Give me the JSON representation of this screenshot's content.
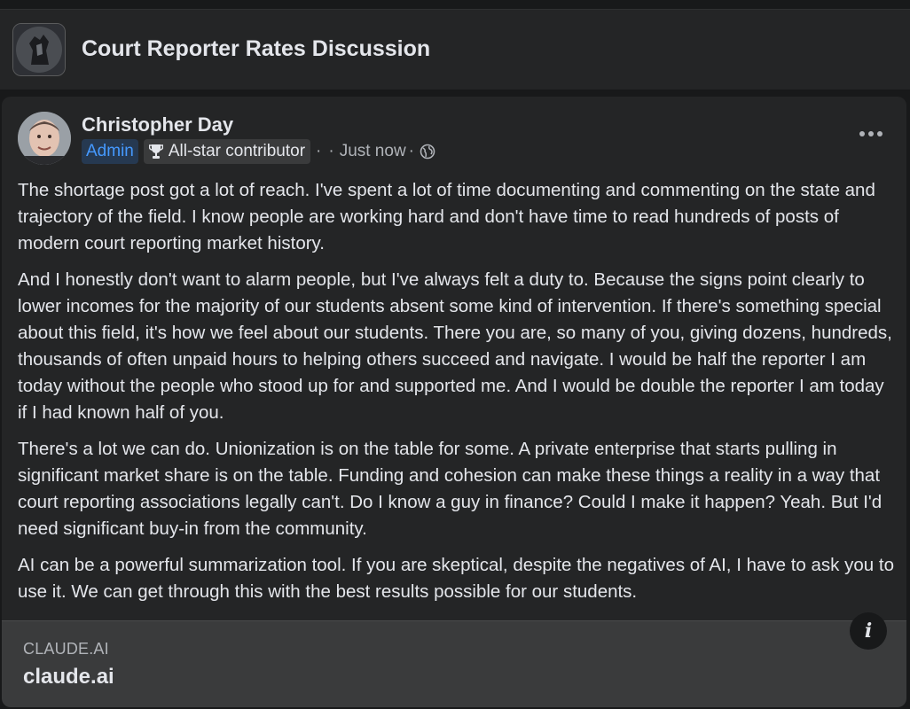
{
  "group": {
    "title": "Court Reporter Rates Discussion",
    "avatar_icon": "group-avatar-icon"
  },
  "post": {
    "author": "Christopher Day",
    "badges": {
      "admin": "Admin",
      "allstar": "All-star contributor"
    },
    "separator1": "·",
    "separator2": "·",
    "time": "Just now",
    "separator3": "·",
    "privacy_icon": "globe-icon",
    "more_icon": "more-options-icon",
    "paragraphs": [
      "The shortage post got a lot of reach. I've spent a lot of time documenting and commenting on the state and trajectory of the field. I know people are working hard and don't have time to read hundreds of posts of modern court reporting market history.",
      "And I honestly don't want to alarm people, but I've always felt a duty to. Because the signs point clearly to lower incomes for the majority of our students absent some kind of intervention. If there's something special about this field, it's how we feel about our students. There you are, so many of you, giving dozens, hundreds, thousands of often unpaid hours to helping others succeed and navigate. I would be half the reporter I am today without the people who stood up for and supported me. And I would be double the reporter I am today if I had known half of you.",
      "There's a lot we can do. Unionization is on the table for some. A private enterprise that starts pulling in significant market share is on the table. Funding and cohesion can make these things a reality in a way that court reporting associations legally can't. Do I know a guy in finance? Could I make it happen? Yeah. But I'd need significant buy-in from the community.",
      "AI can be a powerful summarization tool. If you are skeptical, despite the negatives of AI, I have to ask you to use it. We can get through this with the best results possible for our students."
    ]
  },
  "link_preview": {
    "domain": "CLAUDE.AI",
    "title": "claude.ai",
    "info_icon": "info-icon",
    "info_glyph": "i"
  },
  "colors": {
    "background": "#18191a",
    "card": "#242526",
    "admin_badge_text": "#4599ff",
    "admin_badge_bg": "#263951"
  }
}
